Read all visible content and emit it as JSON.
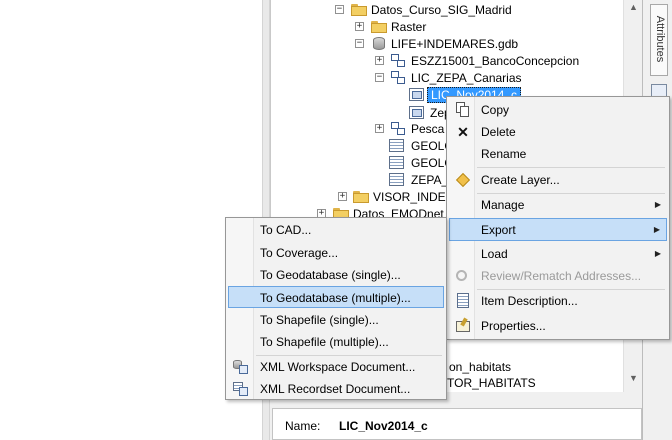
{
  "attributes_tab": "Attributes",
  "tree": {
    "nodes": [
      {
        "label": "Datos_Curso_SIG_Madrid"
      },
      {
        "label": "Raster"
      },
      {
        "label": "LIFE+INDEMARES.gdb"
      },
      {
        "label": "ESZZ15001_BancoConcepcion"
      },
      {
        "label": "LIC_ZEPA_Canarias"
      },
      {
        "label": "LIC_Nov2014_c"
      },
      {
        "label": "Zep"
      },
      {
        "label": "Pesca"
      },
      {
        "label": "GEOLO"
      },
      {
        "label": "GEOLO"
      },
      {
        "label": "ZEPA_L"
      },
      {
        "label": "VISOR_INDEM"
      },
      {
        "label": "Datos_EMODnet"
      },
      {
        "label": "on_habitats"
      },
      {
        "label": "TOR_HABITATS"
      }
    ]
  },
  "context_menu": {
    "items": [
      {
        "label": "Copy",
        "icon": "copy-icon"
      },
      {
        "label": "Delete",
        "icon": "delete-x-icon"
      },
      {
        "label": "Rename",
        "icon": ""
      },
      {
        "label": "Create Layer...",
        "icon": "create-layer-icon"
      },
      {
        "label": "Manage",
        "icon": "",
        "submenu": true
      },
      {
        "label": "Export",
        "icon": "",
        "submenu": true,
        "highlighted": true
      },
      {
        "label": "Load",
        "icon": "",
        "submenu": true
      },
      {
        "label": "Review/Rematch Addresses...",
        "icon": "review-icon",
        "disabled": true
      },
      {
        "label": "Item Description...",
        "icon": "item-description-icon"
      },
      {
        "label": "Properties...",
        "icon": "properties-icon"
      }
    ]
  },
  "export_menu": {
    "items": [
      {
        "label": "To CAD..."
      },
      {
        "label": "To Coverage..."
      },
      {
        "label": "To Geodatabase (single)..."
      },
      {
        "label": "To Geodatabase (multiple)...",
        "highlighted": true
      },
      {
        "label": "To Shapefile (single)..."
      },
      {
        "label": "To Shapefile (multiple)..."
      },
      {
        "label": "XML Workspace Document...",
        "icon": "xml-workspace-icon"
      },
      {
        "label": "XML Recordset Document...",
        "icon": "xml-recordset-icon"
      }
    ]
  },
  "details": {
    "name_label": "Name:",
    "name_value": "LIC_Nov2014_c"
  },
  "colors": {
    "selection": "#3399ff",
    "menu_highlight": "#c6dff8",
    "folder": "#f3cf63"
  }
}
